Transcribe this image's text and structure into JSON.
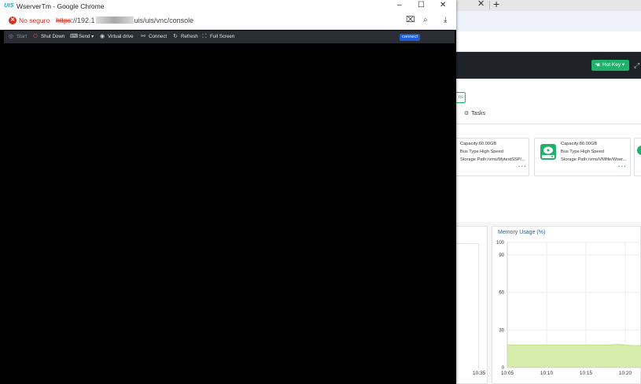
{
  "window": {
    "title": "WserverTm - Google Chrome",
    "logo": "UIS",
    "controls": [
      "–",
      "☐",
      "✕"
    ]
  },
  "address_bar": {
    "security_label": "No seguro",
    "url_scheme": "https",
    "url_host_visible": "://192.1",
    "url_path": "uis/uis/vnc/console"
  },
  "vnc_toolbar": {
    "items": [
      {
        "label": "Start",
        "icon": "power-circle-icon",
        "enabled": false
      },
      {
        "label": "Shut Down",
        "icon": "power-icon",
        "enabled": true
      },
      {
        "label": "Send",
        "icon": "send-icon",
        "enabled": true,
        "dropdown": true
      },
      {
        "label": "Virtual drive",
        "icon": "disc-icon",
        "enabled": true
      },
      {
        "label": "Connect",
        "icon": "link-icon",
        "enabled": true
      },
      {
        "label": "Refresh",
        "icon": "refresh-icon",
        "enabled": true
      },
      {
        "label": "Full Screen",
        "icon": "fullscreen-icon",
        "enabled": true
      }
    ],
    "status_badge": "connect"
  },
  "background_page": {
    "hot_key_label": "Hot Key",
    "tasks_label": "Tasks",
    "disk_cards": [
      {
        "capacity": "Capacity:60.00GB",
        "bus_type": "Bus Type High Speed",
        "storage_path": "Storage Path:/vms/MytestSSP/..."
      },
      {
        "capacity": "Capacity:80.00GB",
        "bus_type": "Bus Type High Speed",
        "storage_path": "Storage Path:/vms/VMfile/Wser..."
      }
    ],
    "left_chart_xtick": "10:35",
    "memory_chart": {
      "title": "Memory Usage (%)"
    }
  },
  "chart_data": {
    "type": "area",
    "title": "Memory Usage (%)",
    "ylim": [
      0,
      100
    ],
    "yticks": [
      "100",
      "90",
      "60",
      "30",
      "0"
    ],
    "xticks": [
      "10:05",
      "10:10",
      "10:15",
      "10:20"
    ],
    "series": [
      {
        "values": [
          18,
          18,
          18,
          18,
          18,
          18,
          18,
          18,
          18,
          18,
          18,
          18,
          18,
          18,
          18.5,
          18,
          17.5,
          17.5
        ]
      }
    ],
    "fill_color": "#d6ecab",
    "line_color": "#c3e08a",
    "grid": true
  }
}
